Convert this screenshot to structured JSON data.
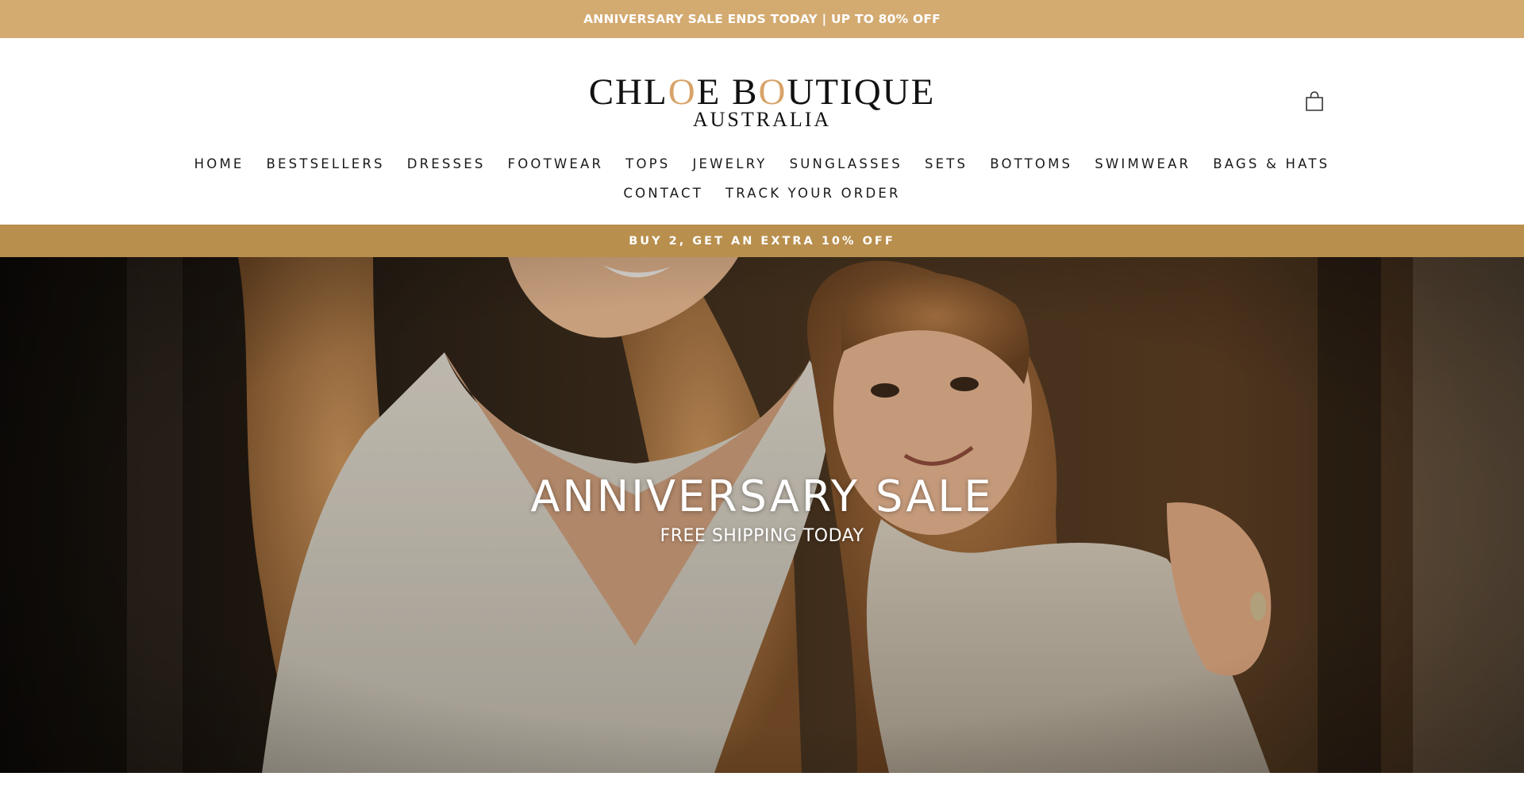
{
  "announcement": {
    "text": "ANNIVERSARY SALE ENDS TODAY | UP TO 80% OFF"
  },
  "header": {
    "logo": {
      "part1": "CHL",
      "o1": "O",
      "part2": "E B",
      "o2": "O",
      "part3": "UTIQUE",
      "sub": "AUSTRALIA"
    },
    "cart_icon": "shopping-bag-icon"
  },
  "nav": {
    "row1": [
      "HOME",
      "BESTSELLERS",
      "DRESSES",
      "FOOTWEAR",
      "TOPS",
      "JEWELRY",
      "SUNGLASSES",
      "SETS",
      "BOTTOMS",
      "SWIMWEAR",
      "BAGS & HATS"
    ],
    "row2": [
      "CONTACT",
      "TRACK YOUR ORDER"
    ]
  },
  "promo": {
    "text": "BUY 2, GET AN EXTRA 10% OFF"
  },
  "hero": {
    "title": "ANNIVERSARY SALE",
    "subtitle": "FREE SHIPPING TODAY"
  },
  "colors": {
    "announcement_bg": "#d3aa70",
    "promo_bg": "#b98f4e",
    "logo_accent": "#d8a36a",
    "text": "#1a1a1a"
  }
}
